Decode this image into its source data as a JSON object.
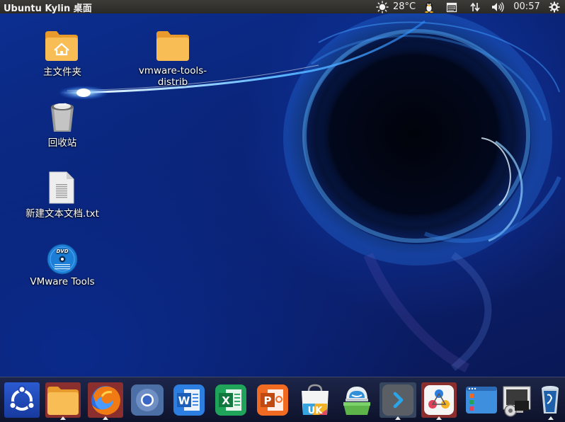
{
  "top_panel": {
    "title": "Ubuntu Kylin 桌面",
    "weather": "28°C",
    "clock": "00:57",
    "icons": [
      "weather-sun-icon",
      "qq-penguin-icon",
      "calendar-icon",
      "network-transfer-icon",
      "volume-icon",
      "power-gear-icon"
    ]
  },
  "desktop": {
    "items": [
      {
        "label": "主文件夹",
        "icon": "home-folder-icon"
      },
      {
        "label": "vmware-tools-",
        "label2": "distrib",
        "icon": "folder-icon"
      },
      {
        "label": "回收站",
        "icon": "trash-icon"
      },
      {
        "label": "新建文本文档.txt",
        "icon": "text-file-icon"
      },
      {
        "label": "VMware Tools",
        "icon": "dvd-icon"
      }
    ]
  },
  "dock": {
    "items": [
      {
        "icon": "ubuntu-logo-icon",
        "running": false
      },
      {
        "icon": "files-icon",
        "running": true
      },
      {
        "icon": "firefox-icon",
        "running": true
      },
      {
        "icon": "chromium-icon",
        "running": false
      },
      {
        "icon": "wps-writer-icon",
        "running": false
      },
      {
        "icon": "wps-spreadsheet-icon",
        "running": false
      },
      {
        "icon": "wps-presentation-icon",
        "running": false
      },
      {
        "icon": "ubuntu-kylin-software-center-icon",
        "running": false
      },
      {
        "icon": "youker-assistant-icon",
        "running": false
      },
      {
        "icon": "terminal-icon",
        "running": true
      },
      {
        "icon": "photo-app-icon",
        "running": true
      },
      {
        "icon": "workspace-switcher-icon",
        "running": false
      },
      {
        "icon": "system-settings-icon",
        "running": false
      },
      {
        "icon": "trash-dock-icon",
        "running": true
      }
    ]
  },
  "colors": {
    "panel": "#2b2a27",
    "folder": "#f8b84e",
    "accent_blue": "#1d7ed8"
  }
}
